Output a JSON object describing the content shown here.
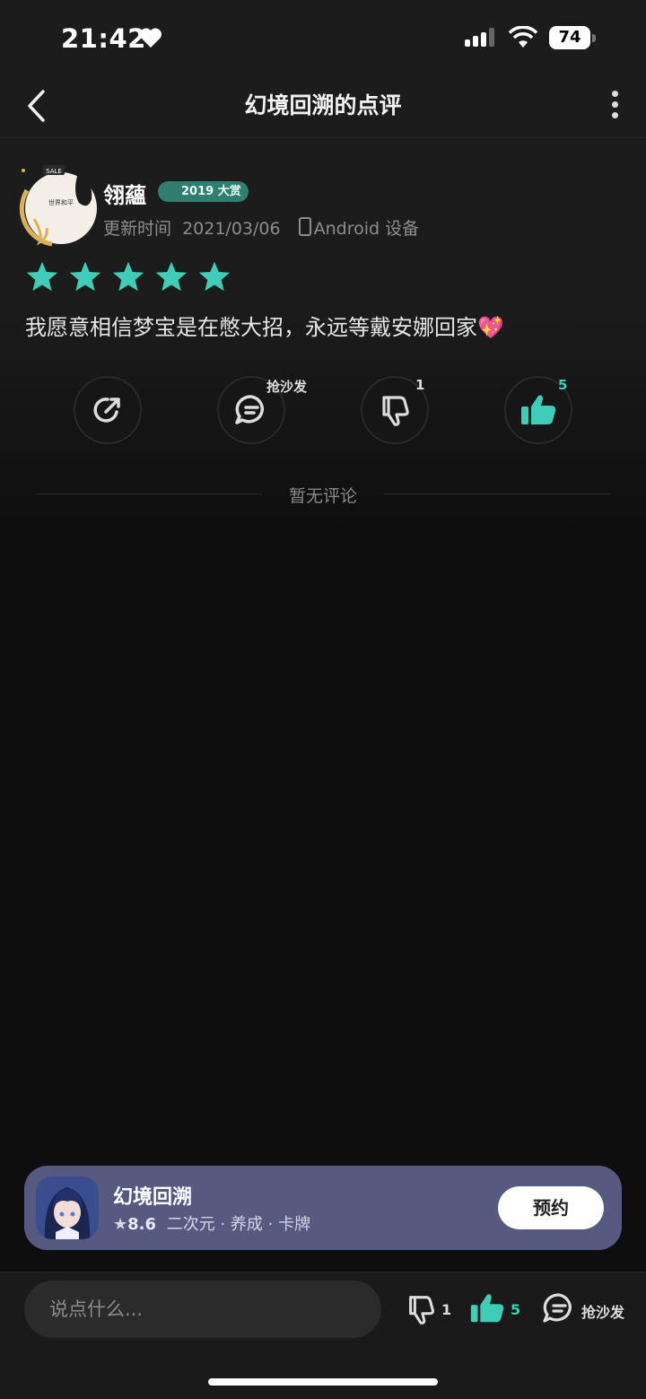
{
  "status_bar": {
    "time": "21:42",
    "battery": "74"
  },
  "nav": {
    "title": "幻境回溯的点评"
  },
  "review": {
    "username": "翎蘊",
    "badge": "2019 大赏",
    "updated_label": "更新时间",
    "updated_date": "2021/03/06",
    "device": "Android 设备",
    "rating": 5,
    "text": "我愿意相信梦宝是在憋大招，永远等戴安娜回家💖",
    "actions": {
      "sofa_label": "抢沙发",
      "dislike_count": "1",
      "like_count": "5"
    },
    "no_comments": "暂无评论"
  },
  "game_card": {
    "name": "幻境回溯",
    "score": "8.6",
    "tags": "二次元 · 养成 · 卡牌",
    "button": "预约"
  },
  "bottom_bar": {
    "input_placeholder": "说点什么...",
    "dislike_count": "1",
    "like_count": "5",
    "sofa_label": "抢沙发"
  },
  "colors": {
    "accent": "#3fcdb8",
    "card": "#575a80",
    "badge": "#2f7e6e"
  }
}
